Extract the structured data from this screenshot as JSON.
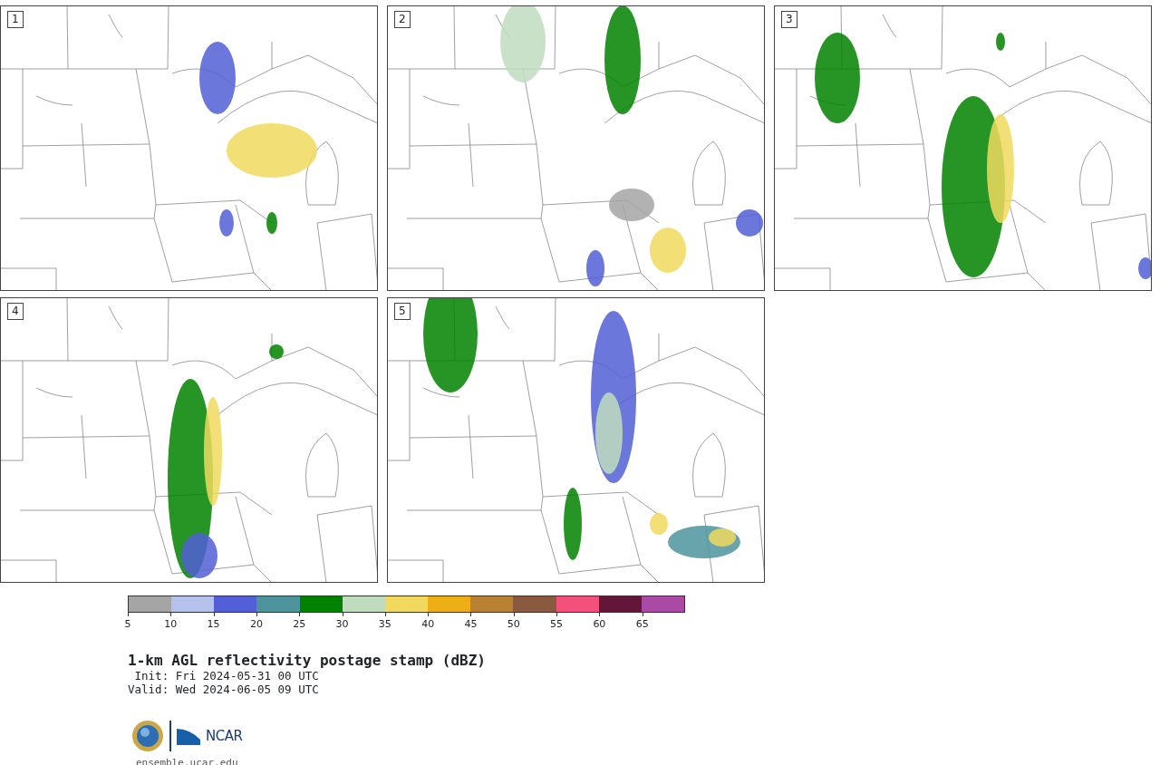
{
  "panels": [
    {
      "label": "1"
    },
    {
      "label": "2"
    },
    {
      "label": "3"
    },
    {
      "label": "4"
    },
    {
      "label": "5"
    }
  ],
  "colorbar": {
    "bins": [
      {
        "color": "#a5a5a5"
      },
      {
        "color": "#b7c2ec"
      },
      {
        "color": "#525fd6"
      },
      {
        "color": "#4e949c"
      },
      {
        "color": "#008200"
      },
      {
        "color": "#bfdcbe"
      },
      {
        "color": "#f0d95e"
      },
      {
        "color": "#eeae16"
      },
      {
        "color": "#b98232"
      },
      {
        "color": "#8a5a40"
      },
      {
        "color": "#f4507c"
      },
      {
        "color": "#621638"
      },
      {
        "color": "#aa4aa4"
      }
    ],
    "ticks": [
      "5",
      "10",
      "15",
      "20",
      "25",
      "30",
      "35",
      "40",
      "45",
      "50",
      "55",
      "60",
      "65"
    ]
  },
  "title": "1-km AGL reflectivity postage stamp (dBZ)",
  "init": " Init: Fri 2024-05-31 00 UTC",
  "valid": "Valid: Wed 2024-06-05 09 UTC",
  "logo": {
    "text": "NCAR"
  },
  "url": "ensemble.ucar.edu"
}
